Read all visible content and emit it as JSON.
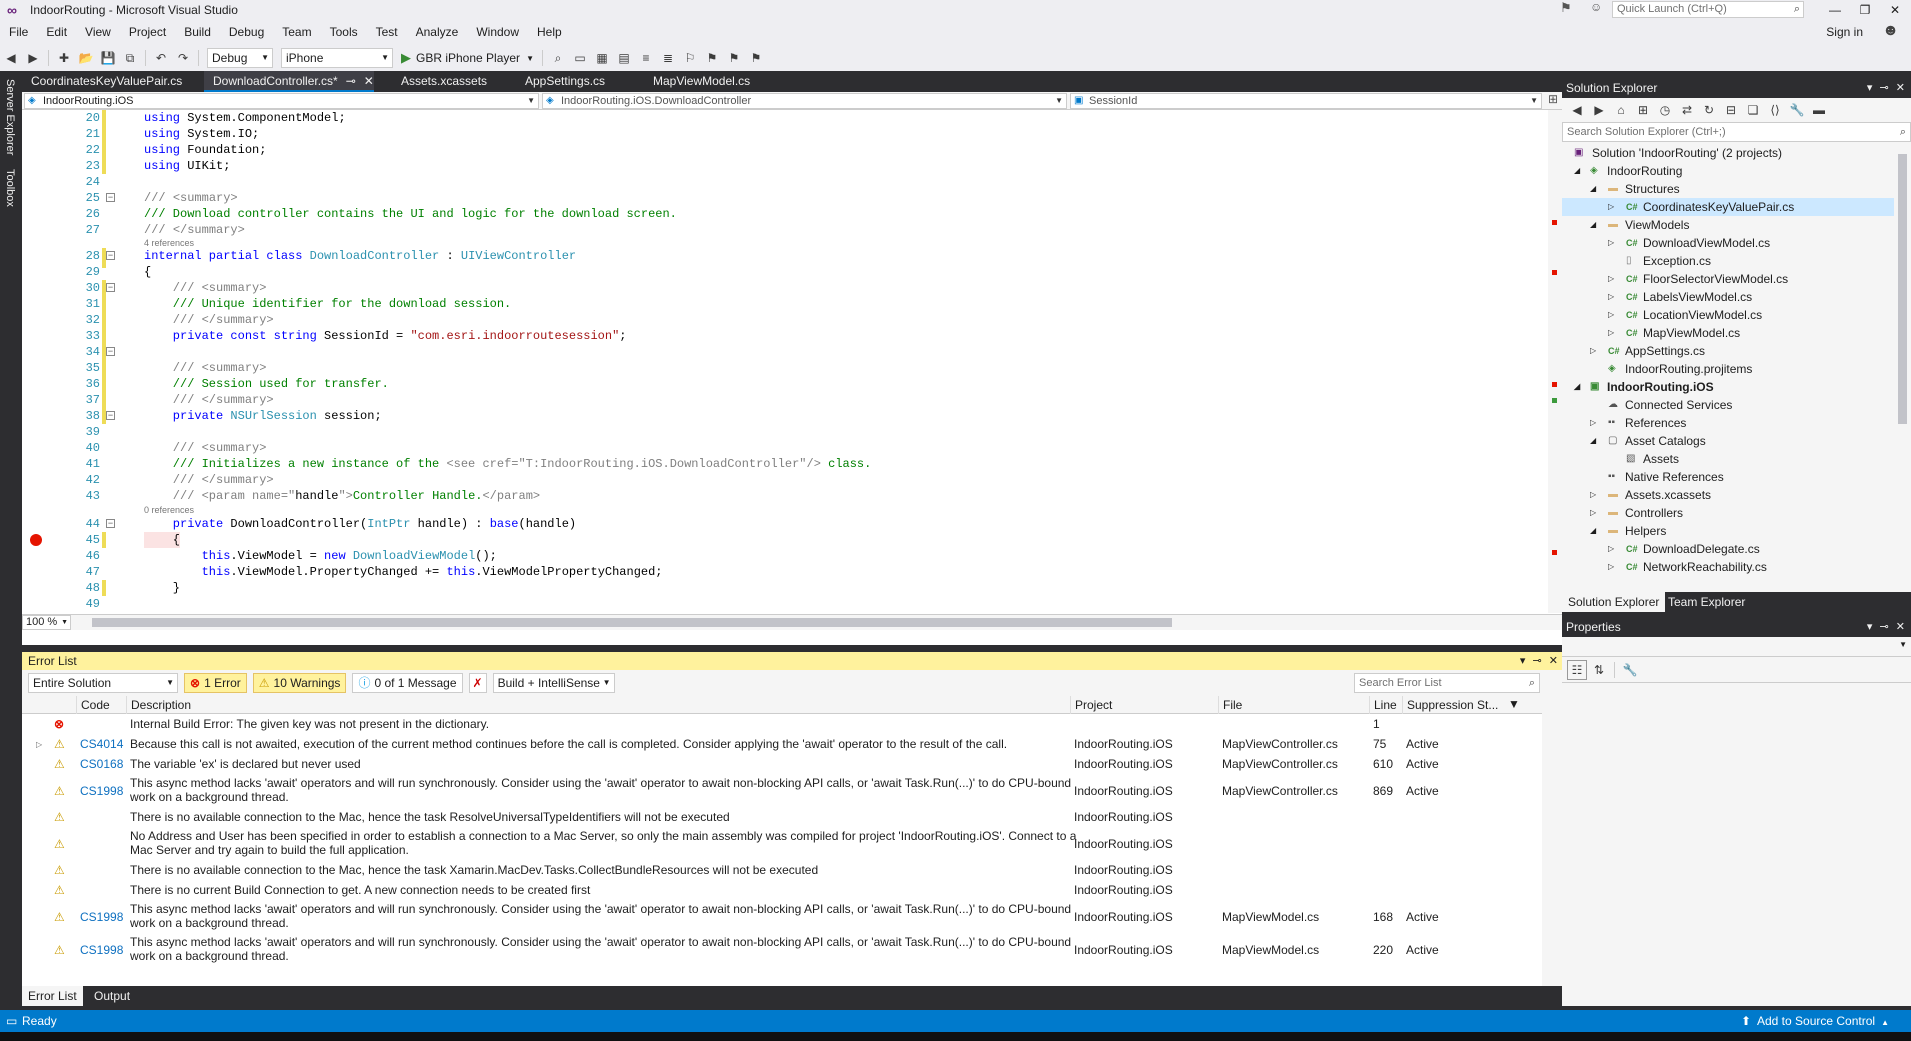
{
  "window": {
    "title": "IndoorRouting - Microsoft Visual Studio",
    "quick_launch_placeholder": "Quick Launch (Ctrl+Q)",
    "sign_in": "Sign in"
  },
  "menu": [
    "File",
    "Edit",
    "View",
    "Project",
    "Build",
    "Debug",
    "Team",
    "Tools",
    "Test",
    "Analyze",
    "Window",
    "Help"
  ],
  "toolbar": {
    "config": "Debug",
    "platform": "iPhone",
    "run_target": "GBR iPhone Player"
  },
  "left_strip": {
    "server_explorer": "Server Explorer",
    "toolbox": "Toolbox"
  },
  "doc_tabs": [
    "CoordinatesKeyValuePair.cs",
    "DownloadController.cs*",
    "Assets.xcassets",
    "AppSettings.cs",
    "MapViewModel.cs"
  ],
  "nav": {
    "project": "IndoorRouting.iOS",
    "type": "IndoorRouting.iOS.DownloadController",
    "member": "SessionId"
  },
  "code": {
    "line_numbers": [
      "20",
      "21",
      "22",
      "23",
      "24",
      "25",
      "26",
      "27",
      "28",
      "29",
      "30",
      "31",
      "32",
      "33",
      "34",
      "35",
      "36",
      "37",
      "38",
      "39",
      "40",
      "41",
      "42",
      "43",
      "44",
      "45",
      "46",
      "47",
      "48",
      "49"
    ],
    "l20_kw": "using",
    "l20_rest": " System.ComponentModel;",
    "l21_kw": "using",
    "l21_rest": " System.IO;",
    "l22_kw": "using",
    "l22_rest": " Foundation;",
    "l23_kw": "using",
    "l23_rest": " UIKit;",
    "l25_a": "/// ",
    "l25_b": "<summary>",
    "l26": "/// Download controller contains the UI and logic for the download screen.",
    "l27_a": "/// ",
    "l27_b": "</summary>",
    "ref_4": "4 references",
    "l28_kw": "internal partial class ",
    "l28_type": "DownloadController",
    "l28_colon": " : ",
    "l28_base": "UIViewController",
    "l29": "{",
    "l30_a": "    /// ",
    "l30_b": "<summary>",
    "l31": "    /// Unique identifier for the download session.",
    "l32_a": "    /// ",
    "l32_b": "</summary>",
    "l33_kw": "    private const string",
    "l33_mid": " SessionId = ",
    "l33_str": "\"com.esri.indoorroutesession\"",
    "l33_end": ";",
    "l35_a": "    /// ",
    "l35_b": "<summary>",
    "l36": "    /// Session used for transfer.",
    "l37_a": "    /// ",
    "l37_b": "</summary>",
    "l38_kw": "    private ",
    "l38_type": "NSUrlSession",
    "l38_rest": " session;",
    "l40_a": "    /// ",
    "l40_b": "<summary>",
    "l41_a": "    /// Initializes a new instance of the ",
    "l41_b": "<see cref=\"T:IndoorRouting.iOS.DownloadController\"/>",
    "l41_c": " class.",
    "l42_a": "    /// ",
    "l42_b": "</summary>",
    "l43_a": "    /// ",
    "l43_b": "<param name=\"",
    "l43_c": "handle",
    "l43_d": "\">",
    "l43_e": "Controller Handle.",
    "l43_f": "</param>",
    "ref_0": "0 references",
    "l44_kw": "    private",
    "l44_mid": " DownloadController(",
    "l44_type": "IntPtr",
    "l44_rest": " handle) : ",
    "l44_base": "base",
    "l44_end": "(handle)",
    "l45": "    {",
    "l46_kw": "        this",
    "l46_mid": ".ViewModel = ",
    "l46_new": "new",
    "l46_sp": " ",
    "l46_type": "DownloadViewModel",
    "l46_end": "();",
    "l47_kw": "        this",
    "l47_mid": ".ViewModel.PropertyChanged += ",
    "l47_this": "this",
    "l47_end": ".ViewModelPropertyChanged;",
    "l48": "    }"
  },
  "zoom": "100 %",
  "error_list": {
    "title": "Error List",
    "scope": "Entire Solution",
    "errors_btn": "1 Error",
    "warnings_btn": "10 Warnings",
    "messages_btn": "0 of 1 Message",
    "build_filter": "Build + IntelliSense",
    "search_placeholder": "Search Error List",
    "columns": {
      "code": "Code",
      "description": "Description",
      "project": "Project",
      "file": "File",
      "line": "Line",
      "suppression": "Suppression St..."
    },
    "rows": [
      {
        "type": "error",
        "code": "",
        "description": "Internal Build Error: The given key was not present in the dictionary.",
        "project": "",
        "file": "",
        "line": "1",
        "suppression": ""
      },
      {
        "type": "warning",
        "code": "CS4014",
        "description": "Because this call is not awaited, execution of the current method continues before the call is completed. Consider applying the 'await' operator to the result of the call.",
        "project": "IndoorRouting.iOS",
        "file": "MapViewController.cs",
        "line": "75",
        "suppression": "Active"
      },
      {
        "type": "warning",
        "code": "CS0168",
        "description": "The variable 'ex' is declared but never used",
        "project": "IndoorRouting.iOS",
        "file": "MapViewController.cs",
        "line": "610",
        "suppression": "Active"
      },
      {
        "type": "warning",
        "code": "CS1998",
        "description": "This async method lacks 'await' operators and will run synchronously. Consider using the 'await' operator to await non-blocking API calls, or 'await Task.Run(...)' to do CPU-bound work on a background thread.",
        "project": "IndoorRouting.iOS",
        "file": "MapViewController.cs",
        "line": "869",
        "suppression": "Active"
      },
      {
        "type": "warning",
        "code": "",
        "description": "There is no available connection to the Mac, hence the task ResolveUniversalTypeIdentifiers will not be executed",
        "project": "IndoorRouting.iOS",
        "file": "",
        "line": "",
        "suppression": ""
      },
      {
        "type": "warning",
        "code": "",
        "description": "No Address and User has been specified in order to establish a connection to a Mac Server, so only the main assembly was compiled for project 'IndoorRouting.iOS'. Connect to a Mac Server and try again to build the full application.",
        "project": "IndoorRouting.iOS",
        "file": "",
        "line": "",
        "suppression": ""
      },
      {
        "type": "warning",
        "code": "",
        "description": "There is no available connection to the Mac, hence the task Xamarin.MacDev.Tasks.CollectBundleResources will not be executed",
        "project": "IndoorRouting.iOS",
        "file": "",
        "line": "",
        "suppression": ""
      },
      {
        "type": "warning",
        "code": "",
        "description": "There is no current Build Connection to get. A new connection needs to be created first",
        "project": "IndoorRouting.iOS",
        "file": "",
        "line": "",
        "suppression": ""
      },
      {
        "type": "warning",
        "code": "CS1998",
        "description": "This async method lacks 'await' operators and will run synchronously. Consider using the 'await' operator to await non-blocking API calls, or 'await Task.Run(...)' to do CPU-bound work on a background thread.",
        "project": "IndoorRouting.iOS",
        "file": "MapViewModel.cs",
        "line": "168",
        "suppression": "Active"
      },
      {
        "type": "warning",
        "code": "CS1998",
        "description": "This async method lacks 'await' operators and will run synchronously. Consider using the 'await' operator to await non-blocking API calls, or 'await Task.Run(...)' to do CPU-bound work on a background thread.",
        "project": "IndoorRouting.iOS",
        "file": "MapViewModel.cs",
        "line": "220",
        "suppression": "Active"
      }
    ],
    "bottom_tabs": [
      "Error List",
      "Output"
    ]
  },
  "solution_explorer": {
    "title": "Solution Explorer",
    "search_placeholder": "Search Solution Explorer (Ctrl+;)",
    "items": [
      {
        "label": "Solution 'IndoorRouting' (2 projects)",
        "icon": "solution-icon"
      },
      {
        "label": "IndoorRouting",
        "icon": "shared-project-icon"
      },
      {
        "label": "Structures",
        "icon": "folder-icon"
      },
      {
        "label": "CoordinatesKeyValuePair.cs",
        "icon": "csharp-file-icon"
      },
      {
        "label": "ViewModels",
        "icon": "folder-icon"
      },
      {
        "label": "DownloadViewModel.cs",
        "icon": "csharp-file-icon"
      },
      {
        "label": "Exception.cs",
        "icon": "file-icon"
      },
      {
        "label": "FloorSelectorViewModel.cs",
        "icon": "csharp-file-icon"
      },
      {
        "label": "LabelsViewModel.cs",
        "icon": "csharp-file-icon"
      },
      {
        "label": "LocationViewModel.cs",
        "icon": "csharp-file-icon"
      },
      {
        "label": "MapViewModel.cs",
        "icon": "csharp-file-icon"
      },
      {
        "label": "AppSettings.cs",
        "icon": "csharp-file-icon"
      },
      {
        "label": "IndoorRouting.projitems",
        "icon": "projitems-icon"
      },
      {
        "label": "IndoorRouting.iOS",
        "icon": "ios-project-icon"
      },
      {
        "label": "Connected Services",
        "icon": "connected-services-icon"
      },
      {
        "label": "References",
        "icon": "references-icon"
      },
      {
        "label": "Asset Catalogs",
        "icon": "asset-catalog-icon"
      },
      {
        "label": "Assets",
        "icon": "assets-icon"
      },
      {
        "label": "Native References",
        "icon": "references-icon"
      },
      {
        "label": "Assets.xcassets",
        "icon": "folder-icon"
      },
      {
        "label": "Controllers",
        "icon": "folder-icon"
      },
      {
        "label": "Helpers",
        "icon": "folder-icon"
      },
      {
        "label": "DownloadDelegate.cs",
        "icon": "csharp-file-icon"
      },
      {
        "label": "NetworkReachability.cs",
        "icon": "csharp-file-icon"
      }
    ],
    "tabs": [
      "Solution Explorer",
      "Team Explorer"
    ]
  },
  "properties": {
    "title": "Properties"
  },
  "status": {
    "ready": "Ready",
    "source_control": "Add to Source Control"
  },
  "colors": {
    "accent": "#007acc",
    "error": "#e51400",
    "warning": "#c99b00",
    "keyword": "#0000ff",
    "comment": "#008000",
    "type": "#2b91af",
    "string": "#a31515"
  }
}
